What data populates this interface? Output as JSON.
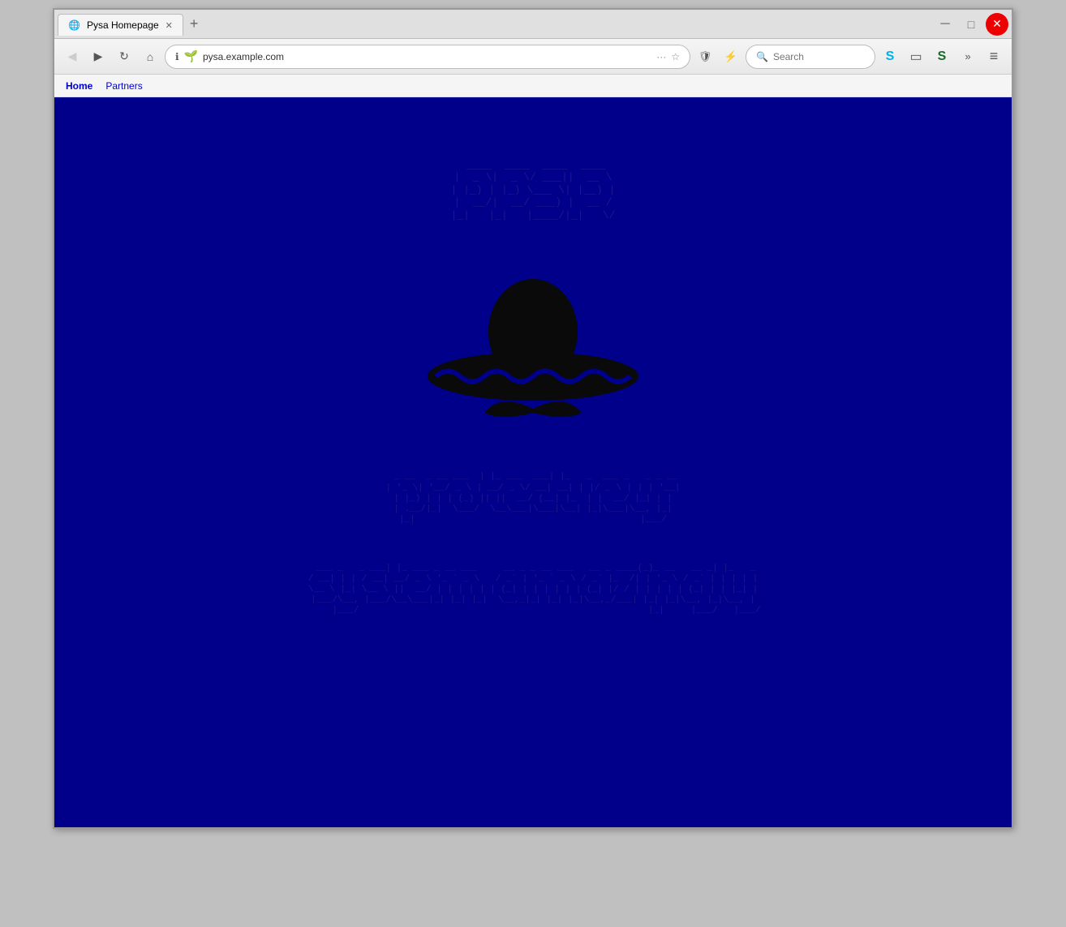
{
  "window": {
    "title": "Pysa Homepage",
    "tab_label": "Pysa Homepage"
  },
  "browser": {
    "back_label": "←",
    "forward_label": "→",
    "reload_label": "↻",
    "home_label": "⌂",
    "more_label": "···",
    "bookmark_label": "☆",
    "shield_label": "🛡",
    "url_info": "ℹ",
    "url_value": "pysa.example.com",
    "search_placeholder": "Search",
    "skype_label": "S",
    "sidebar_label": "▭",
    "simplenote_label": "S",
    "overflow_label": "»",
    "menu_label": "≡"
  },
  "bookmarks": {
    "items": [
      {
        "label": "Home",
        "active": true
      },
      {
        "label": "Partners",
        "active": false
      }
    ]
  },
  "page": {
    "background_color": "#00008b",
    "logo_text": "PYSA",
    "subtitle1": "protectyour",
    "subtitle2": "system amazingly"
  }
}
